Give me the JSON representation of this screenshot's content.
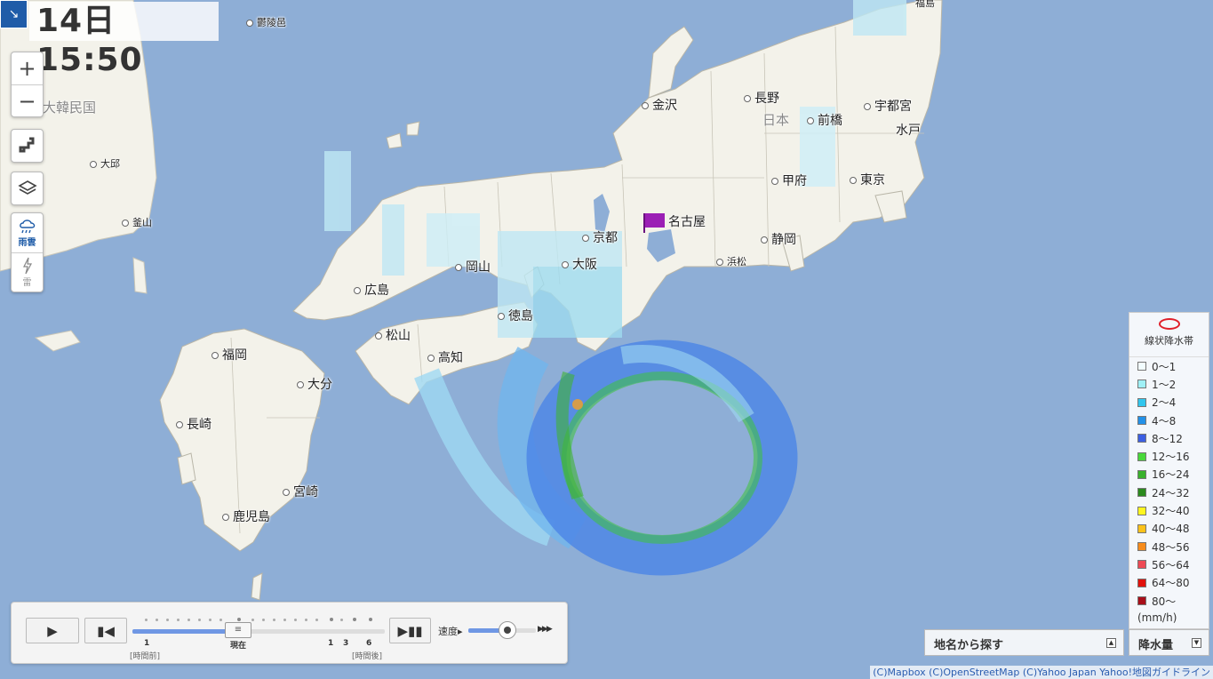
{
  "time": "14日15:50",
  "controls": {
    "zoom_in": "+",
    "zoom_out": "−",
    "layers": [
      {
        "label": "雨雲",
        "icon": "rain-cloud-icon",
        "active": true
      },
      {
        "label": "雷",
        "icon": "lightning-icon",
        "active": false
      }
    ]
  },
  "map": {
    "country_labels": {
      "korea": "大韓民国",
      "japan": "日本"
    },
    "cities": {
      "ulleungdo": "鬱陵邑",
      "daegu": "大邱",
      "busan": "釜山",
      "kanazawa": "金沢",
      "nagano": "長野",
      "maebashi": "前橋",
      "utsunomiya": "宇都宮",
      "mito": "水戸",
      "kofu": "甲府",
      "tokyo": "東京",
      "nagoya": "名古屋",
      "shizuoka": "静岡",
      "hamamatsu": "浜松",
      "kyoto": "京都",
      "osaka": "大阪",
      "okayama": "岡山",
      "hiroshima": "広島",
      "tokushima": "徳島",
      "matsuyama": "松山",
      "kochi": "高知",
      "fukuoka": "福岡",
      "oita": "大分",
      "nagasaki": "長崎",
      "miyazaki": "宮崎",
      "kagoshima": "鹿児島",
      "fukushima": "福島"
    },
    "marker_color": "#9b1fb5"
  },
  "player": {
    "ticks": {
      "past": "1",
      "now": "現在",
      "f1": "1",
      "f3": "3",
      "f6": "6"
    },
    "past_unit": "[時間前]",
    "future_unit": "[時間後]",
    "thumb_label": "≡",
    "speed_label": "速度",
    "speed_arrows": "▶▶▶"
  },
  "search": {
    "label": "地名から探す",
    "toggle": "▲"
  },
  "legend": {
    "linear_band": "線状降水帯",
    "unit": "(mm/h)",
    "toggle_label": "降水量",
    "toggle_icon": "▼",
    "items": [
      {
        "label": "0〜1",
        "color": "#f2fdff"
      },
      {
        "label": "1〜2",
        "color": "#9ff0f6"
      },
      {
        "label": "2〜4",
        "color": "#31c6ee"
      },
      {
        "label": "4〜8",
        "color": "#2391e8"
      },
      {
        "label": "8〜12",
        "color": "#3c5fe2"
      },
      {
        "label": "12〜16",
        "color": "#48d83a"
      },
      {
        "label": "16〜24",
        "color": "#39b12c"
      },
      {
        "label": "24〜32",
        "color": "#2b8a1e"
      },
      {
        "label": "32〜40",
        "color": "#fff51f"
      },
      {
        "label": "40〜48",
        "color": "#fbc21a"
      },
      {
        "label": "48〜56",
        "color": "#f78c1c"
      },
      {
        "label": "56〜64",
        "color": "#ee4a55"
      },
      {
        "label": "64〜80",
        "color": "#e1120d"
      },
      {
        "label": "80〜",
        "color": "#a80f1a"
      }
    ]
  },
  "attribution": "(C)Mapbox (C)OpenStreetMap (C)Yahoo Japan Yahoo!地図ガイドライン",
  "colors": {
    "sea": "#8eaed6",
    "land": "#f3f2ea",
    "accent": "#1f5ca8"
  }
}
